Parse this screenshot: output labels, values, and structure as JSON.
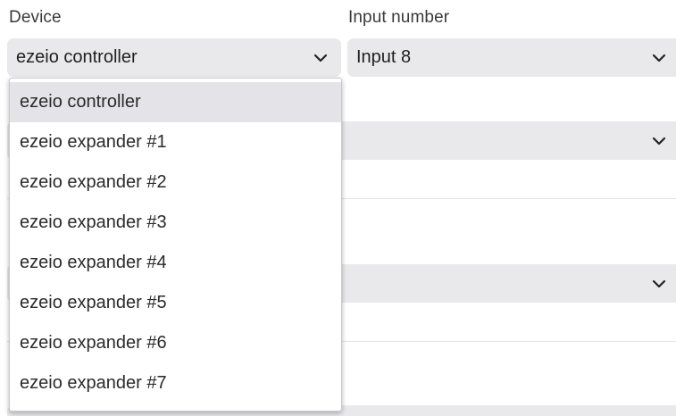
{
  "form": {
    "device_label": "Device",
    "device_value": "ezeio controller",
    "input_label": "Input number",
    "input_value": "Input 8"
  },
  "dropdown": {
    "options": [
      "ezeio controller",
      "ezeio expander #1",
      "ezeio expander #2",
      "ezeio expander #3",
      "ezeio expander #4",
      "ezeio expander #5",
      "ezeio expander #6",
      "ezeio expander #7"
    ],
    "selected_option": "ezeio controller"
  },
  "icons": {
    "select_arrow": "chevron-down-icon"
  },
  "colors": {
    "select_bg": "#e9e9ec",
    "dropdown_bg": "#ffffff",
    "selected_option_bg": "#e4e4e8",
    "text": "#2a2a2a"
  }
}
